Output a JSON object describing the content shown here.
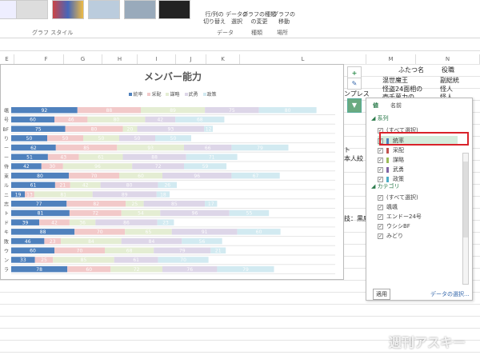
{
  "ribbon": {
    "group_style": "グラフ スタイル",
    "switch_rowcol": "行/列の\n切り替え",
    "select_data": "データの\n選択",
    "change_type": "グラフの種類\nの変更",
    "move_chart": "グラフの\n移動",
    "group_data": "データ",
    "group_type": "種類",
    "group_location": "場所"
  },
  "columns": [
    "E",
    "F",
    "G",
    "H",
    "I",
    "J",
    "K",
    "L",
    "M",
    "N"
  ],
  "cells": {
    "m_header": "ふたつ名",
    "n_header": "役職",
    "m1": "混世魔王",
    "n1": "副総統",
    "m2": "怪盗24面相の",
    "n2": "怪人",
    "m3": "壱千萬力の",
    "n3": "怪人",
    "l_a": "ンプレス",
    "l_b": "ト",
    "l_c": "本人絞",
    "l_d": "技：黒魔"
  },
  "chart_data": {
    "type": "bar",
    "stacked": true,
    "orientation": "horizontal",
    "title": "メンバー能力",
    "categories": [
      "颯",
      "号",
      "BF",
      "り",
      "ー",
      "ー",
      "侍",
      "束",
      "ル",
      "ニ",
      "志",
      "ト",
      "ド",
      "キ",
      "敗",
      "ウ",
      "ン",
      "ラ"
    ],
    "series": [
      {
        "name": "統率",
        "color": "#4f81bd",
        "values": [
          92,
          60,
          75,
          50,
          62,
          51,
          42,
          80,
          61,
          19,
          77,
          81,
          39,
          88,
          46,
          60,
          33,
          78
        ]
      },
      {
        "name": "采配",
        "color": "#f2c9c9",
        "values": [
          88,
          46,
          80,
          50,
          85,
          43,
          30,
          70,
          21,
          13,
          82,
          72,
          42,
          70,
          23,
          70,
          25,
          60
        ]
      },
      {
        "name": "謀略",
        "color": "#e4edd3",
        "values": [
          89,
          80,
          20,
          50,
          93,
          61,
          96,
          60,
          42,
          81,
          25,
          54,
          36,
          65,
          84,
          68,
          85,
          72
        ]
      },
      {
        "name": "武勇",
        "color": "#ddd6e8",
        "values": [
          75,
          42,
          93,
          50,
          66,
          88,
          72,
          96,
          80,
          89,
          85,
          96,
          86,
          91,
          84,
          79,
          61,
          76
        ]
      },
      {
        "name": "政策",
        "color": "#d2eaf1",
        "values": [
          80,
          68,
          12,
          50,
          79,
          71,
          59,
          67,
          26,
          18,
          17,
          55,
          23,
          60,
          56,
          21,
          70,
          79
        ]
      }
    ],
    "xlim": [
      0,
      450
    ],
    "legend": "top",
    "grid": true
  },
  "filter": {
    "tab_values": "値",
    "tab_names": "名前",
    "section_series": "系列",
    "section_category": "カテゴリ",
    "select_all": "(すべて選択)",
    "series_items": [
      {
        "label": "統率",
        "color": "#4f81bd",
        "checked": true
      },
      {
        "label": "采配",
        "color": "#c0504d",
        "checked": true
      },
      {
        "label": "謀略",
        "color": "#9bbb59",
        "checked": true
      },
      {
        "label": "武勇",
        "color": "#8064a2",
        "checked": true
      },
      {
        "label": "政策",
        "color": "#4bacc6",
        "checked": true
      }
    ],
    "category_items": [
      "(すべて選択)",
      "颯颯",
      "エンドー24号",
      "ウシシBF",
      "みどり"
    ],
    "apply": "適用",
    "select_data_link": "データの選択..."
  },
  "watermark": "週刊アスキー"
}
